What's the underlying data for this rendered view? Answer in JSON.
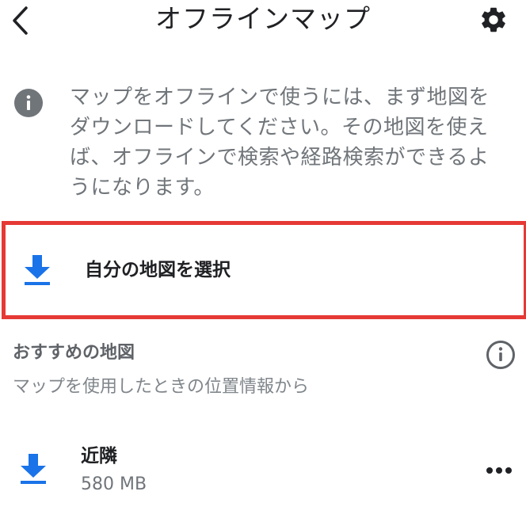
{
  "header": {
    "title": "オフラインマップ",
    "back_icon": "chevron-left-icon",
    "settings_icon": "gear-icon"
  },
  "notice": {
    "icon": "info-icon",
    "lines": [
      "マップをオフラインで使うには、まず地図を",
      "ダウンロードしてください。その地図を使え",
      "ば、オフラインで検索や経路検索ができるよ",
      "うになります。"
    ]
  },
  "select_map": {
    "label": "自分の地図を選択",
    "icon": "download-icon"
  },
  "recommended": {
    "title": "おすすめの地図",
    "subtitle": "マップを使用したときの位置情報から",
    "info_icon": "info-outline-icon",
    "items": [
      {
        "name": "近隣",
        "size": "580 MB",
        "icon": "download-icon",
        "menu_icon": "more-horizontal-icon"
      }
    ]
  },
  "colors": {
    "accent_blue": "#1a73e8",
    "highlight_red": "#e53935",
    "text_primary": "#202124",
    "text_secondary": "#70757a"
  }
}
